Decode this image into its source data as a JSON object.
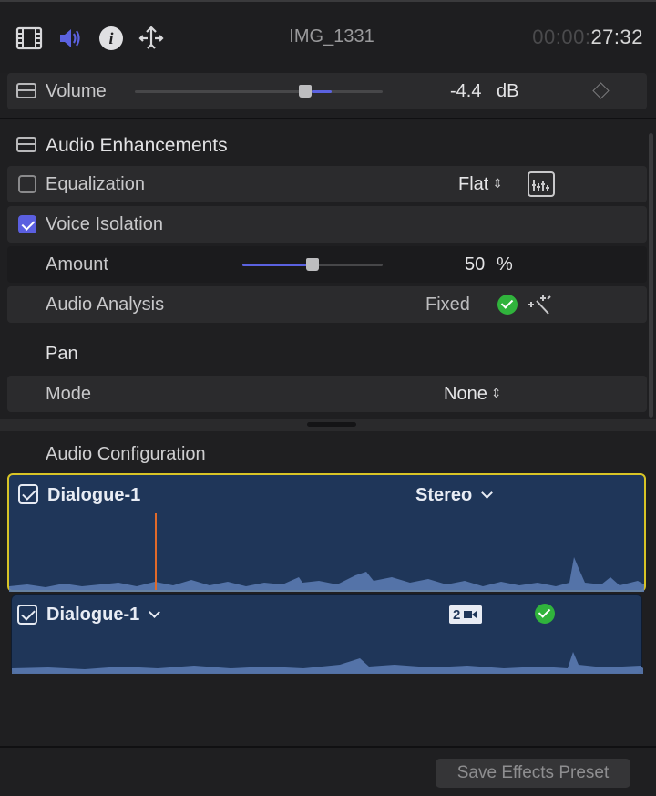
{
  "header": {
    "clip_name": "IMG_1331",
    "timecode_dim": "00:00:",
    "timecode_bright": "27:32",
    "accent_color": "#5b62e0"
  },
  "volume": {
    "label": "Volume",
    "value": "-4.4",
    "unit": "dB"
  },
  "audio_enhancements": {
    "title": "Audio Enhancements",
    "equalization": {
      "label": "Equalization",
      "checked": false,
      "value": "Flat"
    },
    "voice_isolation": {
      "label": "Voice Isolation",
      "checked": true
    },
    "amount": {
      "label": "Amount",
      "value": "50",
      "unit": "%",
      "level": 0.5
    },
    "audio_analysis": {
      "label": "Audio Analysis",
      "value": "Fixed"
    }
  },
  "pan": {
    "title": "Pan",
    "mode_label": "Mode",
    "mode_value": "None"
  },
  "audio_configuration": {
    "title": "Audio Configuration",
    "clip1": {
      "name": "Dialogue-1",
      "channel": "Stereo"
    },
    "clip2": {
      "name": "Dialogue-1",
      "channel_badge": "2"
    }
  },
  "footer": {
    "save_preset": "Save Effects Preset"
  },
  "icons": [
    "video-inspector-icon",
    "audio-inspector-icon",
    "info-inspector-icon",
    "share-inspector-icon",
    "eq-graph-icon",
    "magic-wand-icon"
  ]
}
